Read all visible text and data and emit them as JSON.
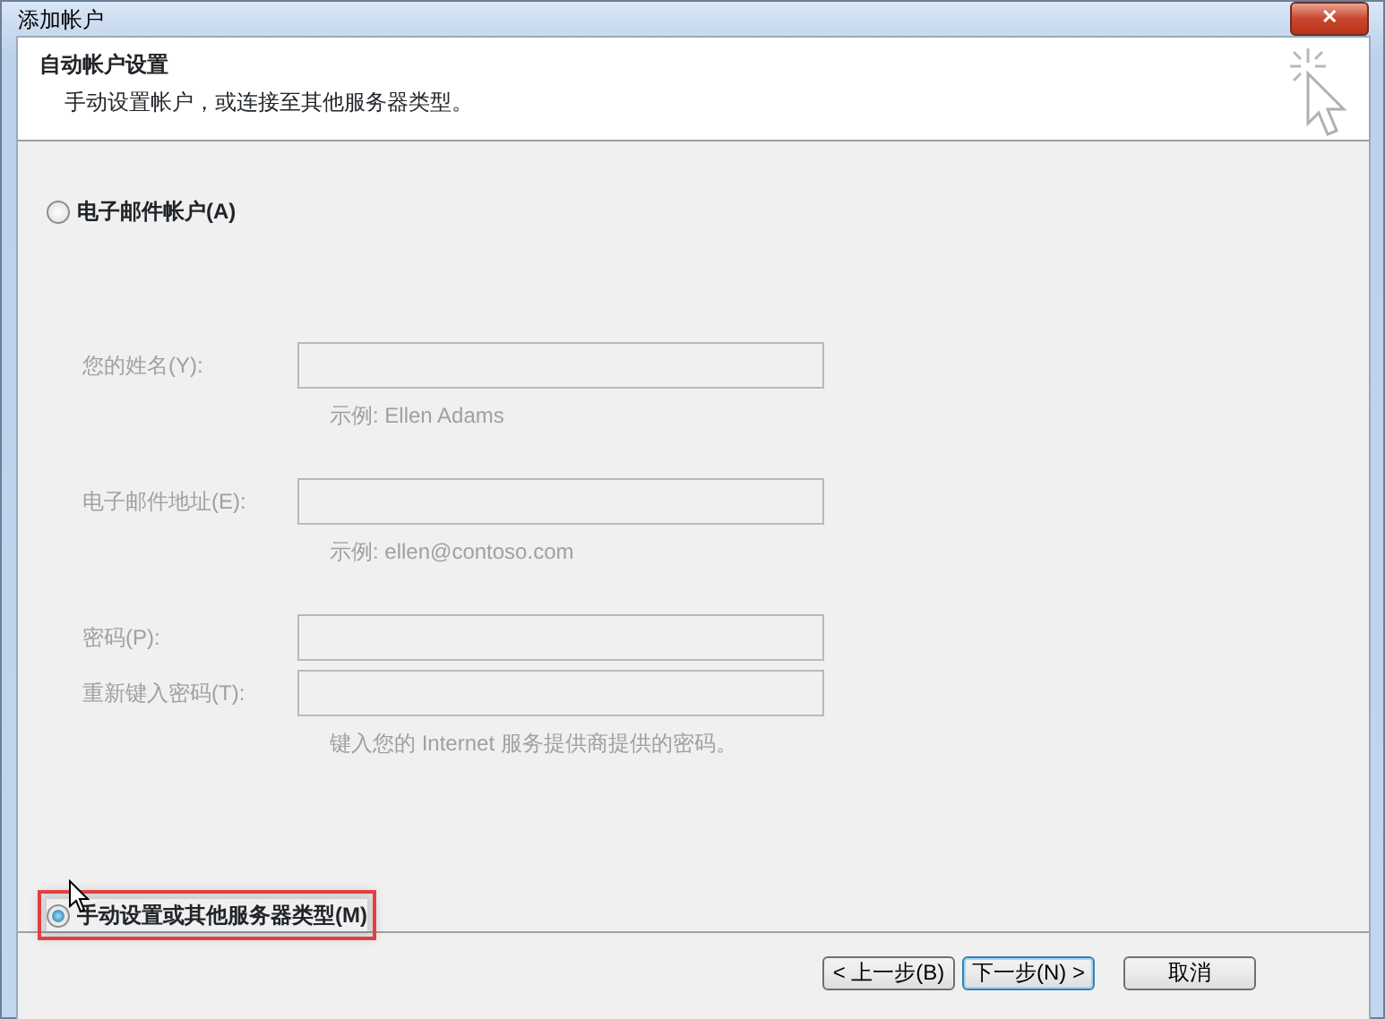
{
  "window": {
    "title": "添加帐户",
    "close_symbol": "✕"
  },
  "header": {
    "title": "自动帐户设置",
    "subtitle": "手动设置帐户，或连接至其他服务器类型。"
  },
  "options": [
    {
      "label": "电子邮件帐户(A)",
      "selected": false,
      "highlighted": false,
      "fields": [
        {
          "label": "您的姓名(Y):",
          "hint": "示例: Ellen Adams",
          "disabled": true
        },
        {
          "label": "电子邮件地址(E):",
          "hint": "示例: ellen@contoso.com",
          "disabled": true
        },
        {
          "label": "密码(P):",
          "disabled": true
        },
        {
          "label": "重新键入密码(T):",
          "hint": "键入您的 Internet 服务提供商提供的密码。",
          "disabled": true
        }
      ]
    },
    {
      "label": "手动设置或其他服务器类型(M)",
      "selected": true,
      "highlighted": true
    }
  ],
  "buttons": [
    {
      "label": "< 上一步(B)",
      "default": false
    },
    {
      "label": "下一步(N) >",
      "default": true
    },
    {
      "label": "取消",
      "default": false
    }
  ]
}
